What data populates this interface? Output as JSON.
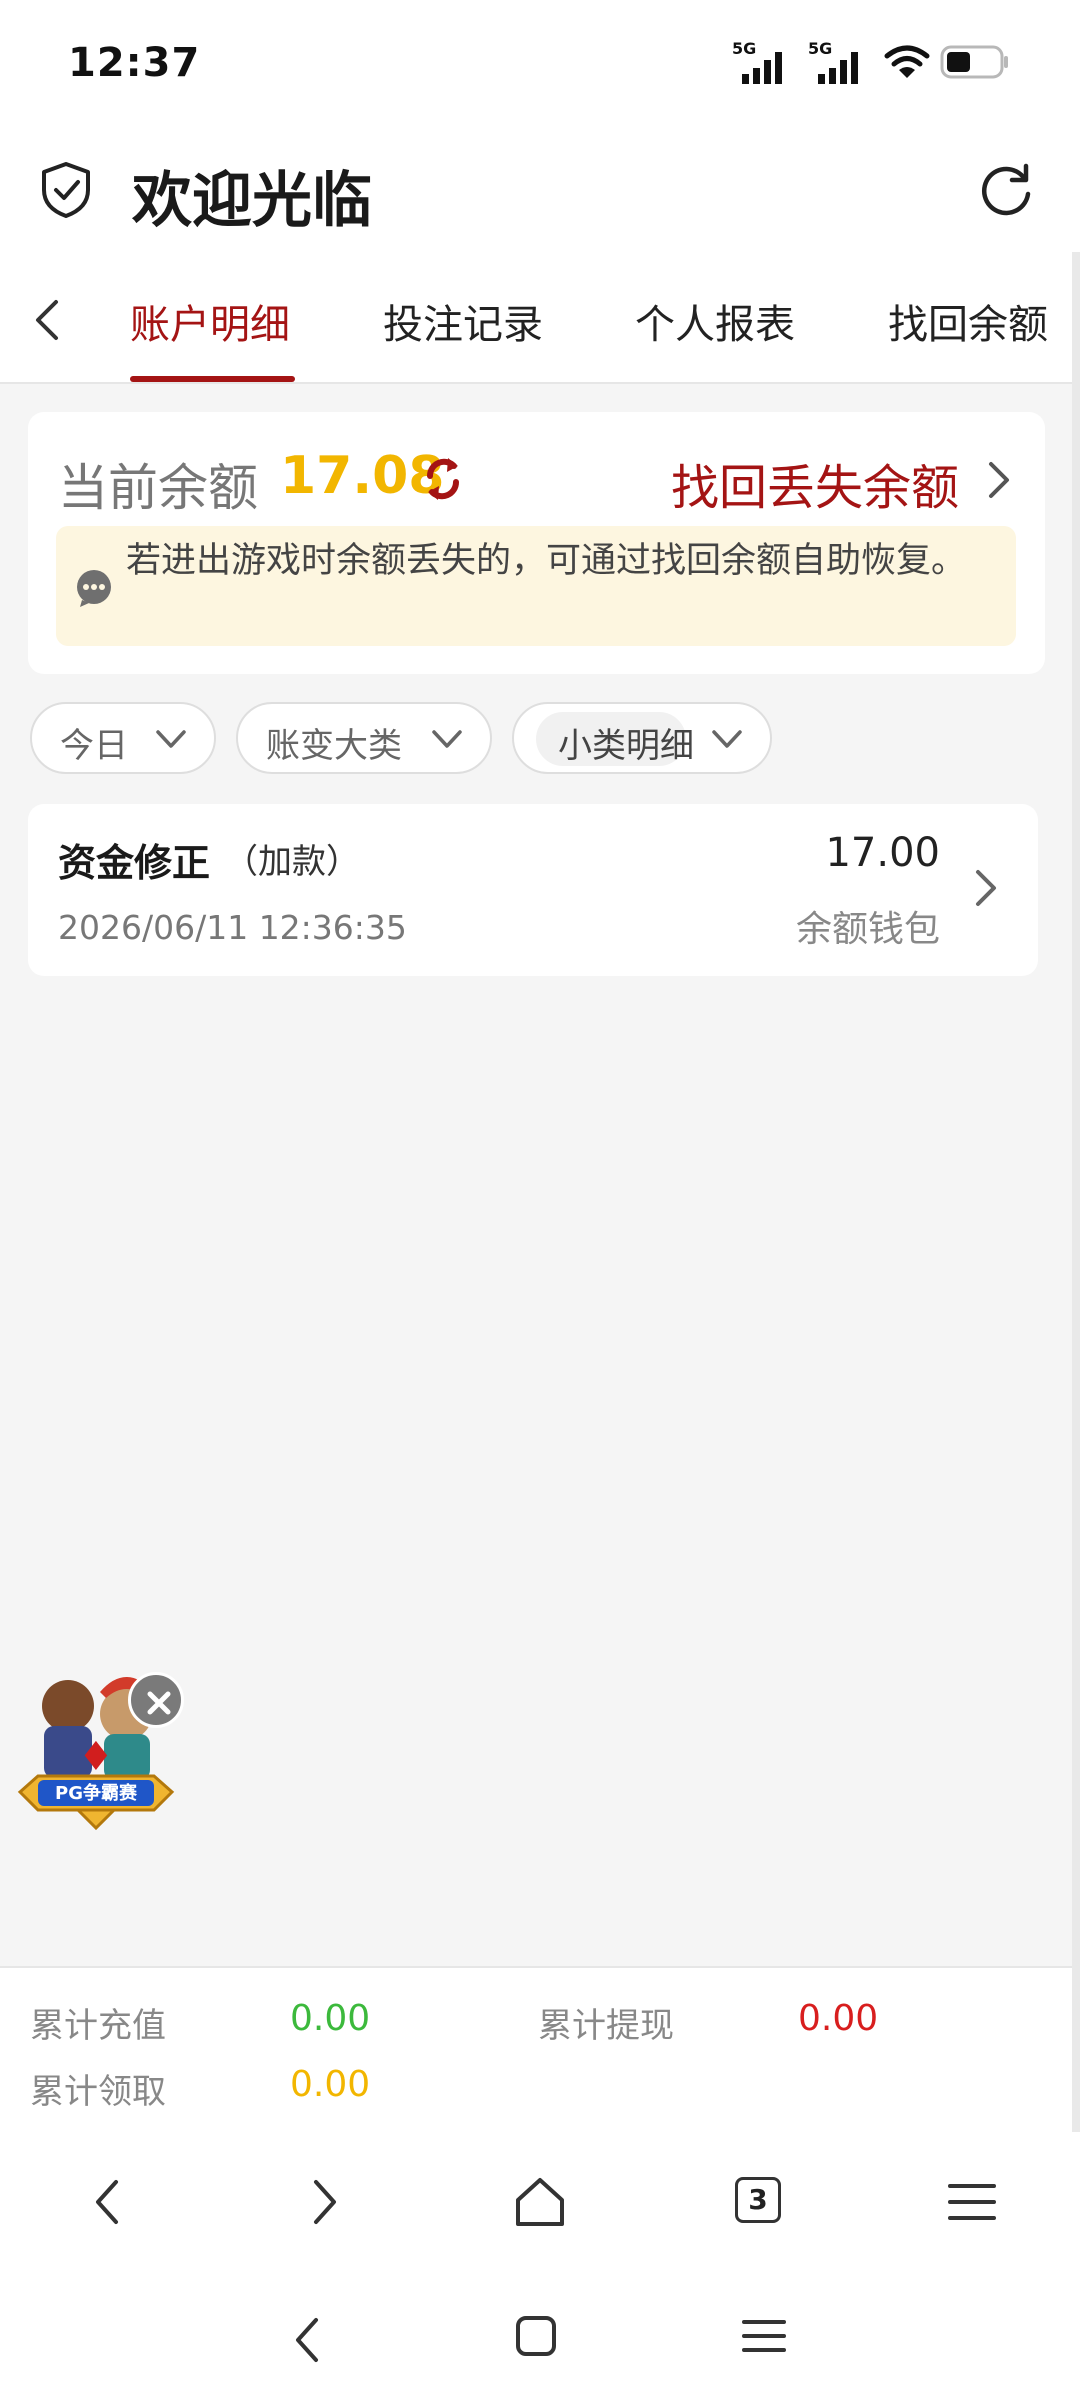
{
  "status_bar": {
    "time": "12:37",
    "network_1": "5G",
    "network_2": "5G",
    "icons": [
      "signal-5g-icon",
      "signal-5g-icon",
      "wifi-icon",
      "battery-icon"
    ],
    "battery_level": 0.45
  },
  "header": {
    "title": "欢迎光临",
    "left_icon": "shield-check-icon",
    "right_icon": "refresh-icon"
  },
  "tabs": {
    "items": [
      {
        "label": "账户明细",
        "active": true
      },
      {
        "label": "投注记录",
        "active": false
      },
      {
        "label": "个人报表",
        "active": false
      },
      {
        "label": "找回余额",
        "active": false
      }
    ]
  },
  "balance": {
    "label": "当前余额",
    "value": "17.08",
    "recover_label": "找回丢失余额",
    "notice": "若进出游戏时余额丢失的，可通过找回余额自助恢复。"
  },
  "filters": [
    {
      "label": "今日"
    },
    {
      "label": "账变大类"
    },
    {
      "label": "小类明细"
    }
  ],
  "records": [
    {
      "title": "资金修正",
      "subtitle": "（加款）",
      "time": "2026/06/11 12:36:35",
      "amount": "17.00",
      "wallet": "余额钱包"
    }
  ],
  "promo": {
    "badge_text": "PG争霸赛"
  },
  "summary": {
    "recharge_label": "累计充值",
    "recharge_value": "0.00",
    "withdraw_label": "累计提现",
    "withdraw_value": "0.00",
    "claim_label": "累计领取",
    "claim_value": "0.00"
  },
  "browser_bar": {
    "tab_count": "3"
  },
  "colors": {
    "brand_red": "#a41414",
    "balance_yellow": "#f2b600",
    "recharge_green": "#3cb93c",
    "withdraw_red": "#d81e1e",
    "notice_bg": "#fdf6e0"
  }
}
